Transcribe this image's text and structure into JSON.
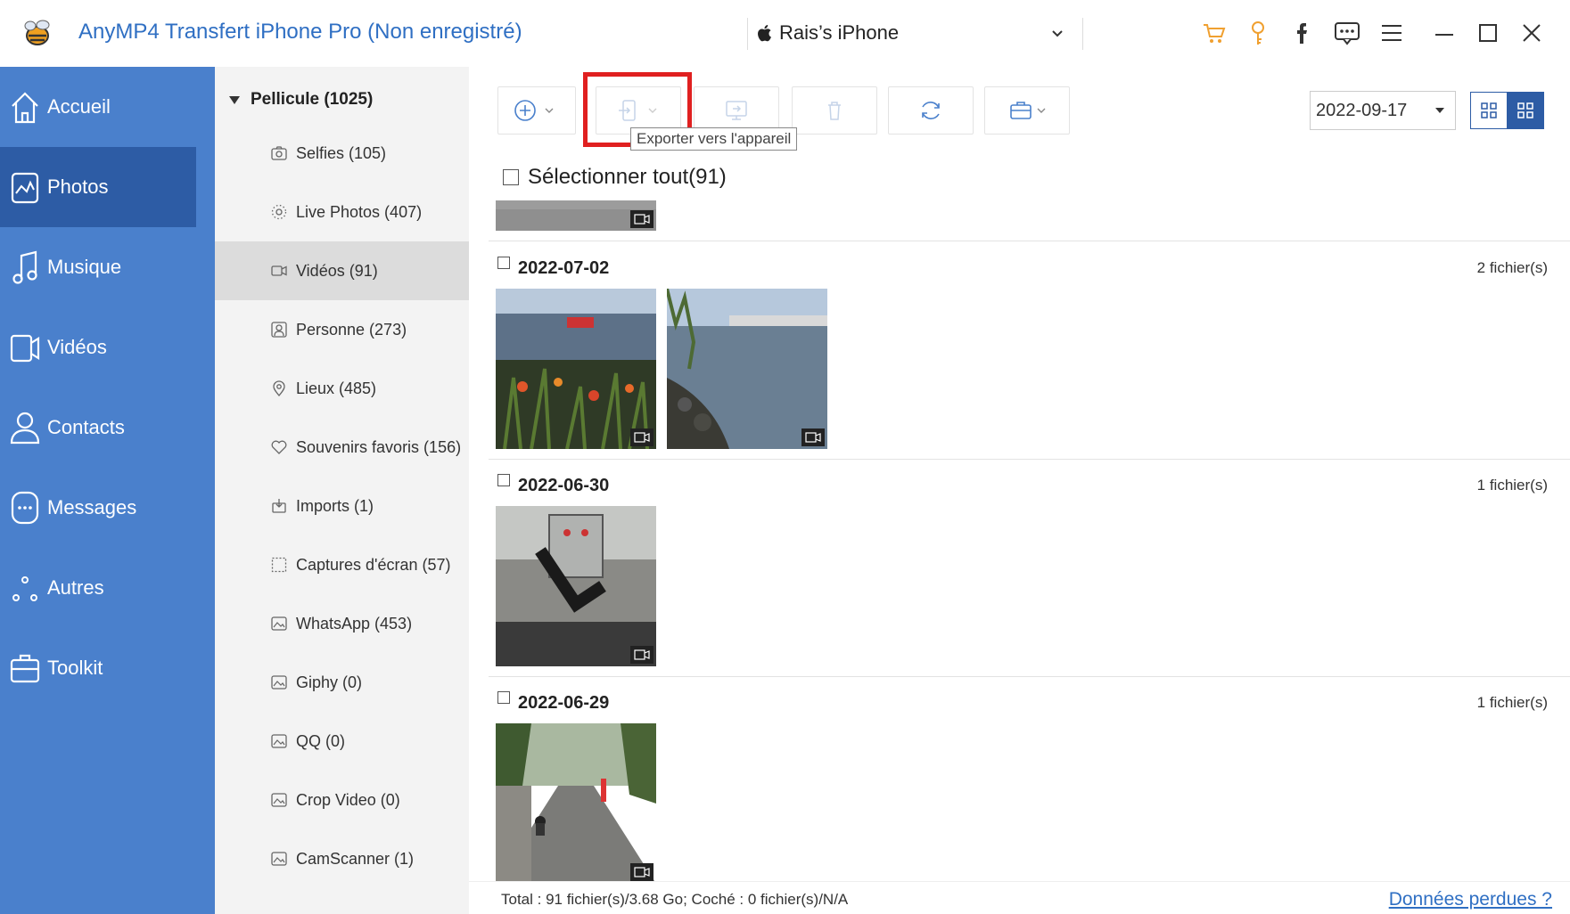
{
  "app": {
    "title": "AnyMP4 Transfert iPhone Pro (Non enregistré)",
    "device_name": "Rais’s iPhone",
    "accent_color": "#2f6fc3",
    "nav_color": "#4a80cc",
    "nav_active_color": "#2d5ca5",
    "highlight_color": "#e02020"
  },
  "titlebar_icons": [
    "cart-icon",
    "key-icon",
    "facebook-icon",
    "feedback-icon",
    "menu-icon",
    "minimize-icon",
    "maximize-icon",
    "close-icon"
  ],
  "nav": {
    "items": [
      {
        "label": "Accueil",
        "icon": "home-icon"
      },
      {
        "label": "Photos",
        "icon": "photos-icon"
      },
      {
        "label": "Musique",
        "icon": "music-icon"
      },
      {
        "label": "Vidéos",
        "icon": "video-icon"
      },
      {
        "label": "Contacts",
        "icon": "contacts-icon"
      },
      {
        "label": "Messages",
        "icon": "messages-icon"
      },
      {
        "label": "Autres",
        "icon": "others-icon"
      },
      {
        "label": "Toolkit",
        "icon": "toolkit-icon"
      }
    ],
    "active_index": 1
  },
  "albums": {
    "root_label": "Pellicule (1025)",
    "items": [
      {
        "label": "Selfies (105)",
        "icon": "selfie-icon"
      },
      {
        "label": "Live Photos (407)",
        "icon": "live-photo-icon"
      },
      {
        "label": "Vidéos (91)",
        "icon": "video-album-icon"
      },
      {
        "label": "Personne (273)",
        "icon": "person-icon"
      },
      {
        "label": "Lieux (485)",
        "icon": "location-icon"
      },
      {
        "label": "Souvenirs favoris (156)",
        "icon": "heart-icon"
      },
      {
        "label": "Imports (1)",
        "icon": "import-icon"
      },
      {
        "label": "Captures d'écran (57)",
        "icon": "screenshot-icon"
      },
      {
        "label": "WhatsApp (453)",
        "icon": "album-icon"
      },
      {
        "label": "Giphy (0)",
        "icon": "album-icon"
      },
      {
        "label": "QQ (0)",
        "icon": "album-icon"
      },
      {
        "label": "Crop Video (0)",
        "icon": "album-icon"
      },
      {
        "label": "CamScanner (1)",
        "icon": "album-icon"
      }
    ],
    "active_index": 2
  },
  "toolbar": {
    "tooltip": "Exporter vers l'appareil",
    "date_value": "2022-09-17"
  },
  "content": {
    "select_all_label": "Sélectionner tout(91)",
    "groups": [
      {
        "date": "2022-07-02",
        "count": "2 fichier(s)"
      },
      {
        "date": "2022-06-30",
        "count": "1 fichier(s)"
      },
      {
        "date": "2022-06-29",
        "count": "1 fichier(s)"
      }
    ]
  },
  "footer": {
    "stats": "Total : 91 fichier(s)/3.68 Go; Coché : 0 fichier(s)/N/A",
    "link": "Données perdues ?"
  }
}
